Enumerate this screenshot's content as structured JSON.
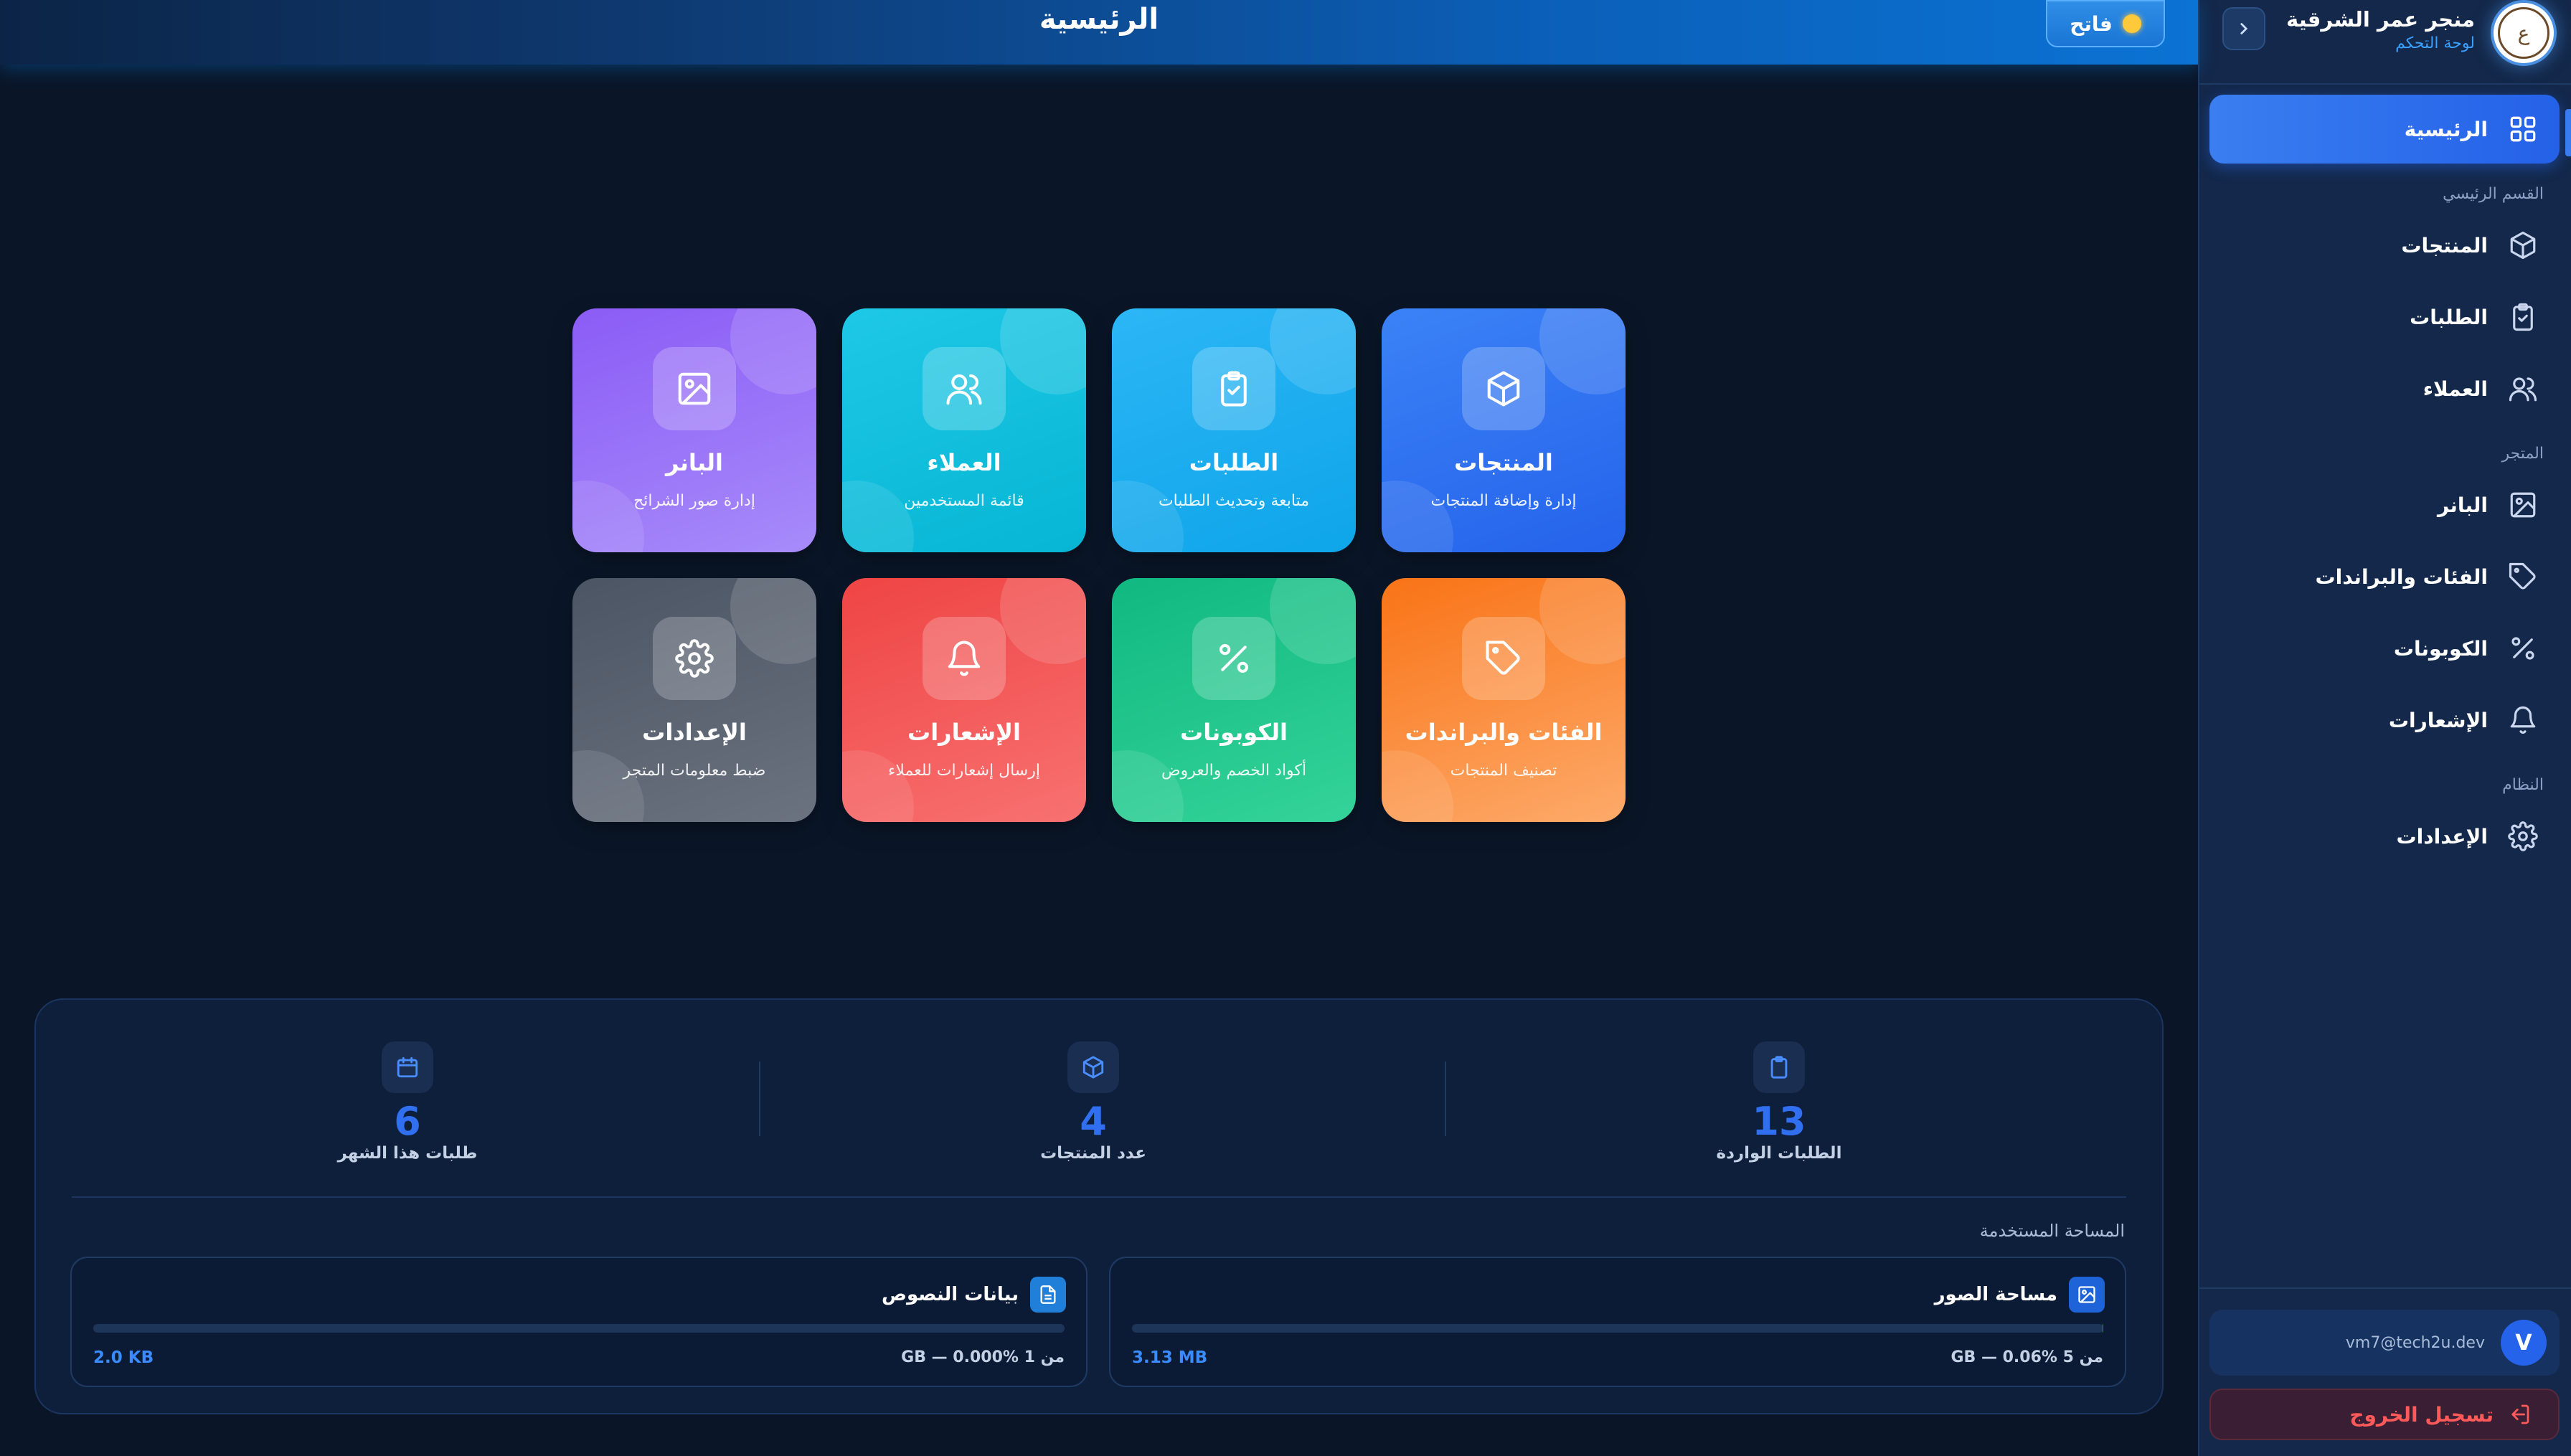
{
  "header": {
    "title": "الرئيسية",
    "theme_label": "فاتح"
  },
  "brand": {
    "name": "منجر عمر الشرقية",
    "subtitle": "لوحة التحكم",
    "logo_text": "ع"
  },
  "sidebar": {
    "home": "الرئيسية",
    "section_main": "القسم الرئيسي",
    "products": "المنتجات",
    "orders": "الطلبات",
    "customers": "العملاء",
    "section_store": "المتجر",
    "banner": "البانر",
    "categories": "الفئات والبراندات",
    "coupons": "الكوبونات",
    "notifications": "الإشعارات",
    "section_system": "النظام",
    "settings": "الإعدادات",
    "user_initial": "V",
    "user_email": "vm7@tech2u.dev",
    "logout": "تسجيل الخروج"
  },
  "cards": [
    {
      "title": "المنتجات",
      "sub": "إدارة وإضافة المنتجات",
      "icon": "box-icon",
      "color": "#2f6ff0"
    },
    {
      "title": "الطلبات",
      "sub": "متابعة وتحديث الطلبات",
      "icon": "clipboard-check-icon",
      "color": "#1aa3f0"
    },
    {
      "title": "العملاء",
      "sub": "قائمة المستخدمين",
      "icon": "users-icon",
      "color": "#12c0e0"
    },
    {
      "title": "البانر",
      "sub": "إدارة صور الشرائح",
      "icon": "image-icon",
      "color": "#9b5cf6"
    },
    {
      "title": "الفئات والبراندات",
      "sub": "تصنيف المنتجات",
      "icon": "tag-icon",
      "color": "#fb8a3c"
    },
    {
      "title": "الكوبونات",
      "sub": "أكواد الخصم والعروض",
      "icon": "percent-icon",
      "color": "#1ec98c"
    },
    {
      "title": "الإشعارات",
      "sub": "إرسال إشعارات للعملاء",
      "icon": "bell-icon",
      "color": "#f25a5a"
    },
    {
      "title": "الإعدادات",
      "sub": "ضبط معلومات المتجر",
      "icon": "gear-icon",
      "color": "#5b6578"
    }
  ],
  "stats": [
    {
      "value": "13",
      "label": "الطلبات الواردة",
      "icon": "clipboard-icon"
    },
    {
      "value": "4",
      "label": "عدد المنتجات",
      "icon": "box-icon"
    },
    {
      "value": "6",
      "label": "طلبات هذا الشهر",
      "icon": "calendar-icon"
    }
  ],
  "storage": {
    "title": "المساحة المستخدمة",
    "images": {
      "label": "مساحة الصور",
      "used": "3.13 MB",
      "quota": "من 5 GB — 0.06%",
      "percent": 0.06
    },
    "text": {
      "label": "بيانات النصوص",
      "used": "2.0 KB",
      "quota": "من 1 GB — 0.000%",
      "percent": 0.0
    }
  }
}
